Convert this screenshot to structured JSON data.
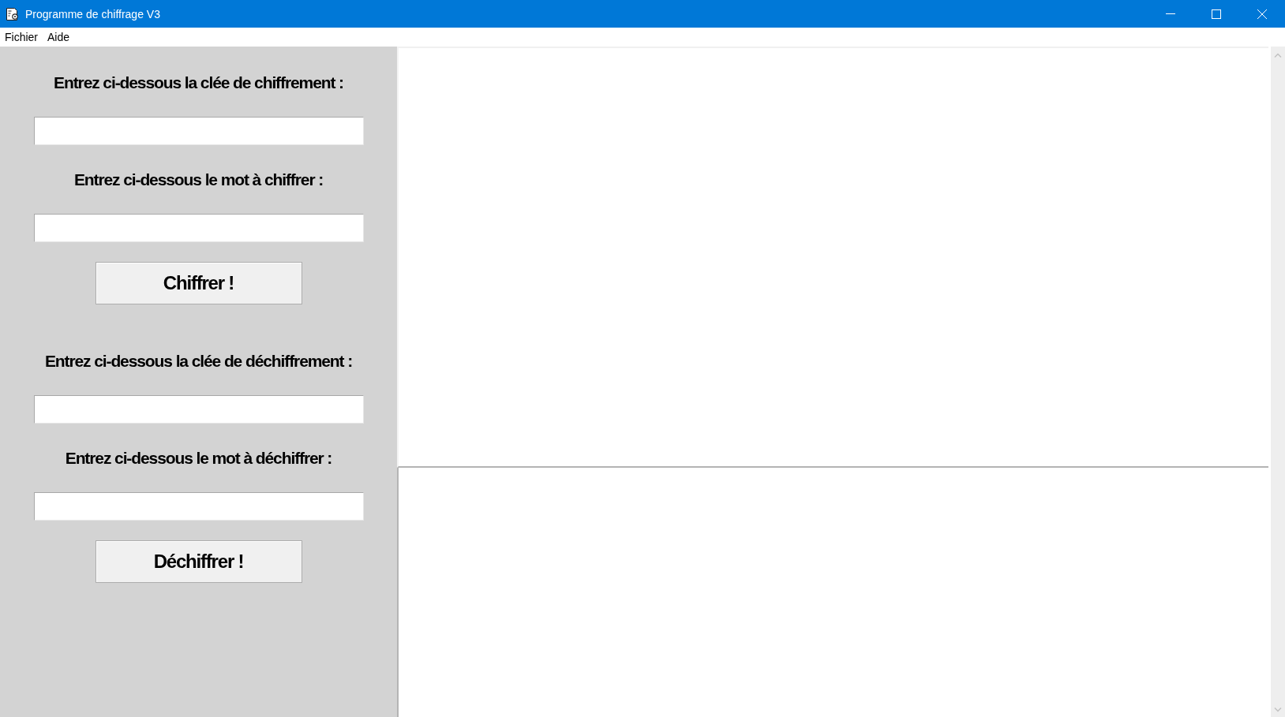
{
  "window": {
    "title": "Programme de chiffrage V3"
  },
  "menu": [
    {
      "label": "Fichier"
    },
    {
      "label": "Aide"
    }
  ],
  "form": {
    "sections": [
      {
        "fields": [
          {
            "label": "Entrez ci-dessous la clée de chiffrement :"
          },
          {
            "label": "Entrez ci-dessous le mot à chiffrer :"
          }
        ],
        "button": "Chiffrer !"
      },
      {
        "fields": [
          {
            "label": "Entrez ci-dessous la clée de déchiffrement :"
          },
          {
            "label": "Entrez ci-dessous le mot à déchiffrer :"
          }
        ],
        "button": "Déchiffrer !"
      }
    ]
  }
}
